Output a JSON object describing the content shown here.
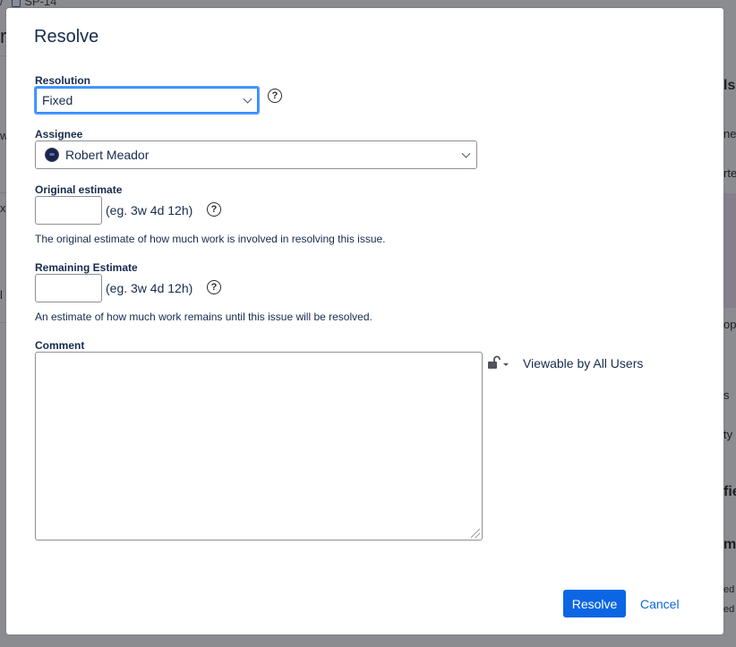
{
  "background": {
    "crumb_text": "SP-14",
    "left_fragments": [
      "re",
      "w",
      "x",
      "l"
    ],
    "right_fragments": [
      "ls",
      "ne",
      "rte",
      "op",
      "s",
      "ty",
      "fie",
      "ma",
      "ed",
      "ed"
    ]
  },
  "dialog": {
    "title": "Resolve",
    "resolution": {
      "label": "Resolution",
      "selected": "Fixed",
      "help_icon": "question-circle-icon"
    },
    "assignee": {
      "label": "Assignee",
      "selected": "Robert Meador"
    },
    "original_estimate": {
      "label": "Original estimate",
      "value": "",
      "hint": "(eg. 3w 4d 12h)",
      "description": "The original estimate of how much work is involved in resolving this issue."
    },
    "remaining_estimate": {
      "label": "Remaining Estimate",
      "value": "",
      "hint": "(eg. 3w 4d 12h)",
      "description": "An estimate of how much work remains until this issue will be resolved."
    },
    "comment": {
      "label": "Comment",
      "value": "",
      "visibility_icon": "unlock-icon",
      "visibility": "Viewable by All Users"
    },
    "buttons": {
      "submit": "Resolve",
      "cancel": "Cancel"
    }
  },
  "colors": {
    "primary": "#0c66e4",
    "focus_ring": "#4c9aff",
    "text": "#172b4d"
  }
}
